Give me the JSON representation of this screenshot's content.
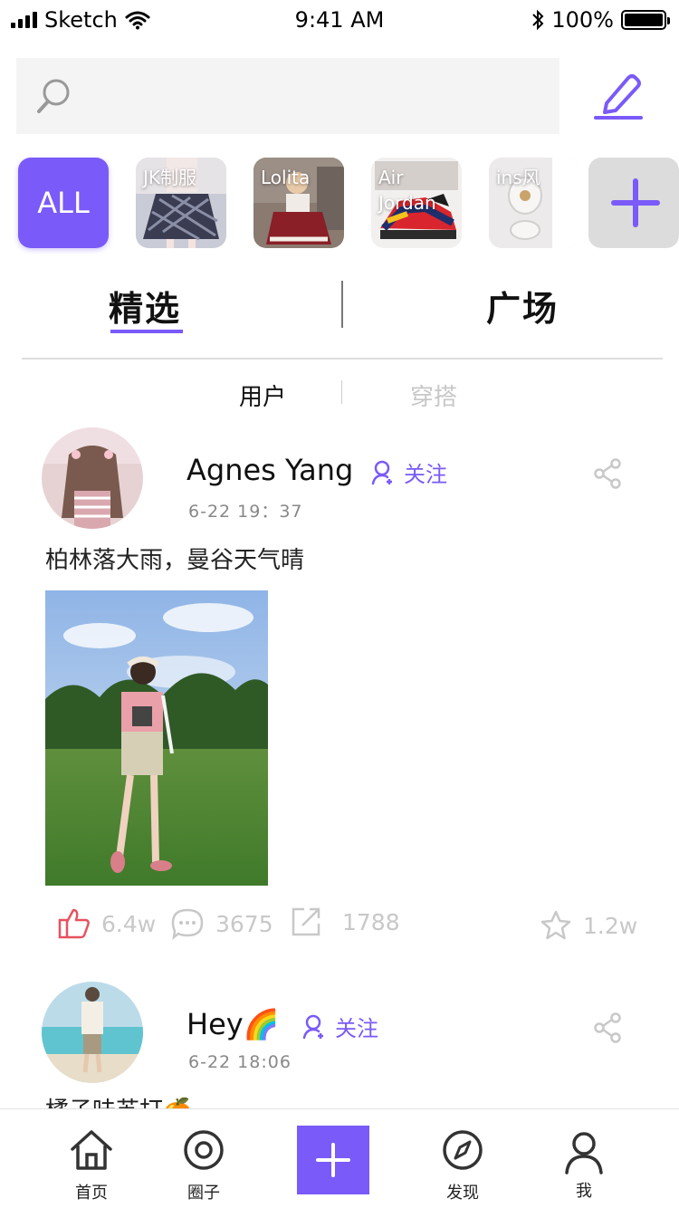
{
  "status_bar": {
    "carrier": "Sketch",
    "time": "9:41 AM",
    "battery": "100%"
  },
  "search": {
    "placeholder": "",
    "value": ""
  },
  "categories": [
    {
      "label": "ALL",
      "active": true
    },
    {
      "label": "JK制服"
    },
    {
      "label": "Lolita"
    },
    {
      "label": "Air Jordan"
    },
    {
      "label": "ins风"
    }
  ],
  "tabs": {
    "featured": "精选",
    "square": "广场"
  },
  "subtabs": {
    "users": "用户",
    "outfits": "穿搭"
  },
  "posts": [
    {
      "username": "Agnes Yang",
      "follow": "关注",
      "time": "6-22 19：37",
      "text": "柏林落大雨，曼谷天气晴",
      "likes": "6.4w",
      "comments": "3675",
      "shares": "1788",
      "favorites": "1.2w"
    },
    {
      "username": "Hey🌈",
      "follow": "关注",
      "time": "6-22 18:06",
      "text": "橘子味苏打🍊"
    }
  ],
  "nav": {
    "home": "首页",
    "circle": "圈子",
    "discover": "发现",
    "me": "我"
  },
  "colors": {
    "accent": "#7a5af8",
    "like": "#e8515e"
  }
}
